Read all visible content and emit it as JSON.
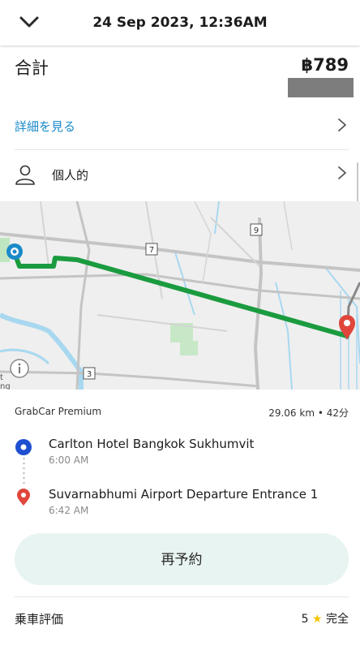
{
  "header": {
    "date": "24 Sep 2023, 12:36AM",
    "back_icon": "chevron-down-icon"
  },
  "summary": {
    "total_label": "合計",
    "total_amount": "฿789",
    "details_label": "詳細を見る",
    "profile_label": "個人的"
  },
  "map": {
    "road_labels": [
      "7",
      "9",
      "3"
    ],
    "partial_text": [
      "t",
      "ng"
    ],
    "route_color": "#1a9b3f",
    "origin_color": "#1a8ac9",
    "destination_color": "#e0463b"
  },
  "ride": {
    "service": "GrabCar Premium",
    "distance_time": "29.06 km • 42分",
    "pickup": {
      "name": "Carlton Hotel Bangkok Sukhumvit",
      "time": "6:00 AM"
    },
    "dropoff": {
      "name": "Suvarnabhumi Airport Departure Entrance 1",
      "time": "6:42 AM"
    }
  },
  "actions": {
    "rebook_label": "再予約"
  },
  "rating": {
    "label": "乗車評価",
    "value": "5",
    "star": "★",
    "status": "完全"
  },
  "colors": {
    "accent_blue": "#1a8ac9",
    "rebook_bg": "#e8f4f1",
    "star": "#f5c400"
  }
}
